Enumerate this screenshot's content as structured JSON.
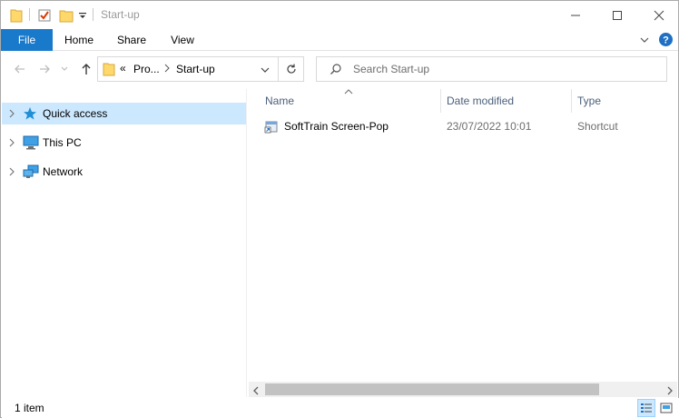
{
  "window": {
    "title": "Start-up"
  },
  "ribbon": {
    "tabs": [
      "File",
      "Home",
      "Share",
      "View"
    ]
  },
  "address": {
    "overflow": "«",
    "crumbs": [
      "Pro...",
      "Start-up"
    ]
  },
  "search": {
    "placeholder": "Search Start-up"
  },
  "nav": {
    "items": [
      {
        "label": "Quick access",
        "icon": "star-icon",
        "selected": true
      },
      {
        "label": "This PC",
        "icon": "computer-icon",
        "selected": false
      },
      {
        "label": "Network",
        "icon": "network-icon",
        "selected": false
      }
    ]
  },
  "columns": [
    "Name",
    "Date modified",
    "Type"
  ],
  "files": [
    {
      "name": "SoftTrain Screen-Pop",
      "date_modified": "23/07/2022 10:01",
      "type": "Shortcut"
    }
  ],
  "status": {
    "item_count": "1 item"
  },
  "colors": {
    "accent": "#1979ca",
    "selection": "#cce8ff",
    "header_text": "#4c607a"
  }
}
